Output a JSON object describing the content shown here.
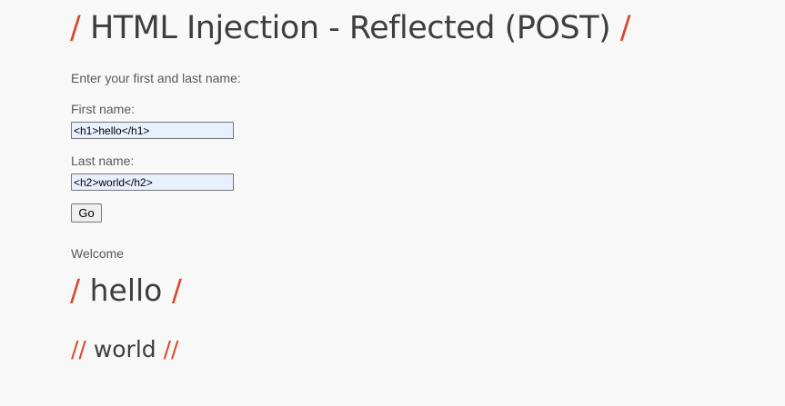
{
  "page": {
    "title": "HTML Injection - Reflected (POST)",
    "title_slash": "/",
    "intro": "Enter your first and last name:"
  },
  "form": {
    "first_name_label": "First name:",
    "first_name_value": "<h1>hello</h1>",
    "last_name_label": "Last name:",
    "last_name_value": "<h2>world</h2>",
    "go_label": "Go"
  },
  "result": {
    "welcome": "Welcome",
    "h1_slash": "/",
    "h1_text": "hello",
    "h2_slash": "//",
    "h2_text": "world"
  },
  "colors": {
    "accent": "#d9492d",
    "heading": "#3e3e3e",
    "text": "#595959",
    "input_bg": "#e8f0fe"
  }
}
